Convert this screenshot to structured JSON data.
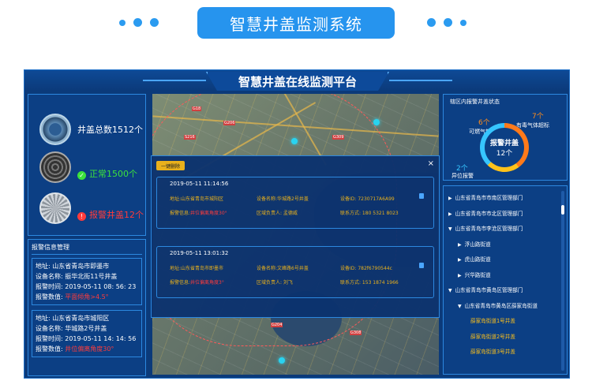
{
  "banner": {
    "title": "智慧井盖监测系统"
  },
  "platform": {
    "title": "智慧井盖在线监测平台"
  },
  "summary": {
    "total": "井盖总数1512个",
    "normal": "正常1500个",
    "alarm": "报警井盖12个"
  },
  "alarm_info": {
    "title": "报警信息管理",
    "cards": [
      {
        "address": "地址: 山东省青岛市即墨市",
        "device": "设备名称: 振华北街11号井盖",
        "time": "报警时间: 2019-05-11 08: 56: 23",
        "value_label": "报警数值:",
        "value": "平面倾角>4.5°"
      },
      {
        "address": "地址: 山东省青岛市城阳区",
        "device": "设备名称: 华城路2号井盖",
        "time": "报警时间: 2019-05-11 14: 14: 56",
        "value_label": "报警数值:",
        "value": "井位偏离角度30°"
      }
    ]
  },
  "popup": {
    "tag": "一键删除",
    "close": "×",
    "alerts": [
      {
        "time": "2019-05-11 11:14:56",
        "address": "地址:山东省青岛市城阳区",
        "device": "设备名称:华城路2号井盖",
        "device_id": "设备ID: 7230717A6A99",
        "info_label": "报警信息:",
        "info": "井位偏离角度30°",
        "owner": "区域负责人: 孟德威",
        "contact": "联系方式: 180 5321 8023"
      },
      {
        "time": "2019-05-11 13:01:32",
        "address": "地址:山东省青岛市即墨市",
        "device": "设备名称:文峰路6号井盖",
        "device_id": "设备ID: 782f6790544c",
        "info_label": "报警信息:",
        "info": "井位偏离角度3°",
        "owner": "区域负责人: 刘飞",
        "contact": "联系方式: 153 1874 1966"
      }
    ]
  },
  "status": {
    "title": "辖区内报警井盖状态",
    "center_title": "报警井盖",
    "center_count": "12个",
    "gas_count": "7个",
    "gas_label": "有毒气体超标",
    "fuel_count": "6个",
    "fuel_label": "可燃气超标",
    "pos_count": "2个",
    "pos_label": "异位报警"
  },
  "tree": [
    {
      "level": 1,
      "label": "山东省青岛市市南区管理部门"
    },
    {
      "level": 1,
      "label": "山东省青岛市市北区管理部门"
    },
    {
      "level": 1,
      "label": "山东省青岛市李沧区管理部门",
      "open": true
    },
    {
      "level": 2,
      "label": "浮山路街道"
    },
    {
      "level": 2,
      "label": "虎山路街道"
    },
    {
      "level": 2,
      "label": "兴华路街道"
    },
    {
      "level": 1,
      "label": "山东省青岛市黄岛区管理部门",
      "open": true
    },
    {
      "level": 2,
      "label": "山东省青岛市黄岛区薛家岛街道",
      "open": true
    },
    {
      "level": 3,
      "label": "薛家岛街道1号井盖"
    },
    {
      "level": 3,
      "label": "薛家岛街道2号井盖"
    },
    {
      "level": 3,
      "label": "薛家岛街道3号井盖"
    }
  ],
  "map_labels": [
    "G18",
    "G206",
    "G309",
    "S216",
    "G204",
    "G308"
  ],
  "colors": {
    "accent": "#2694ee",
    "alarm": "#ff3b3b",
    "ok": "#3ce23c",
    "warn": "#e9b11c"
  }
}
